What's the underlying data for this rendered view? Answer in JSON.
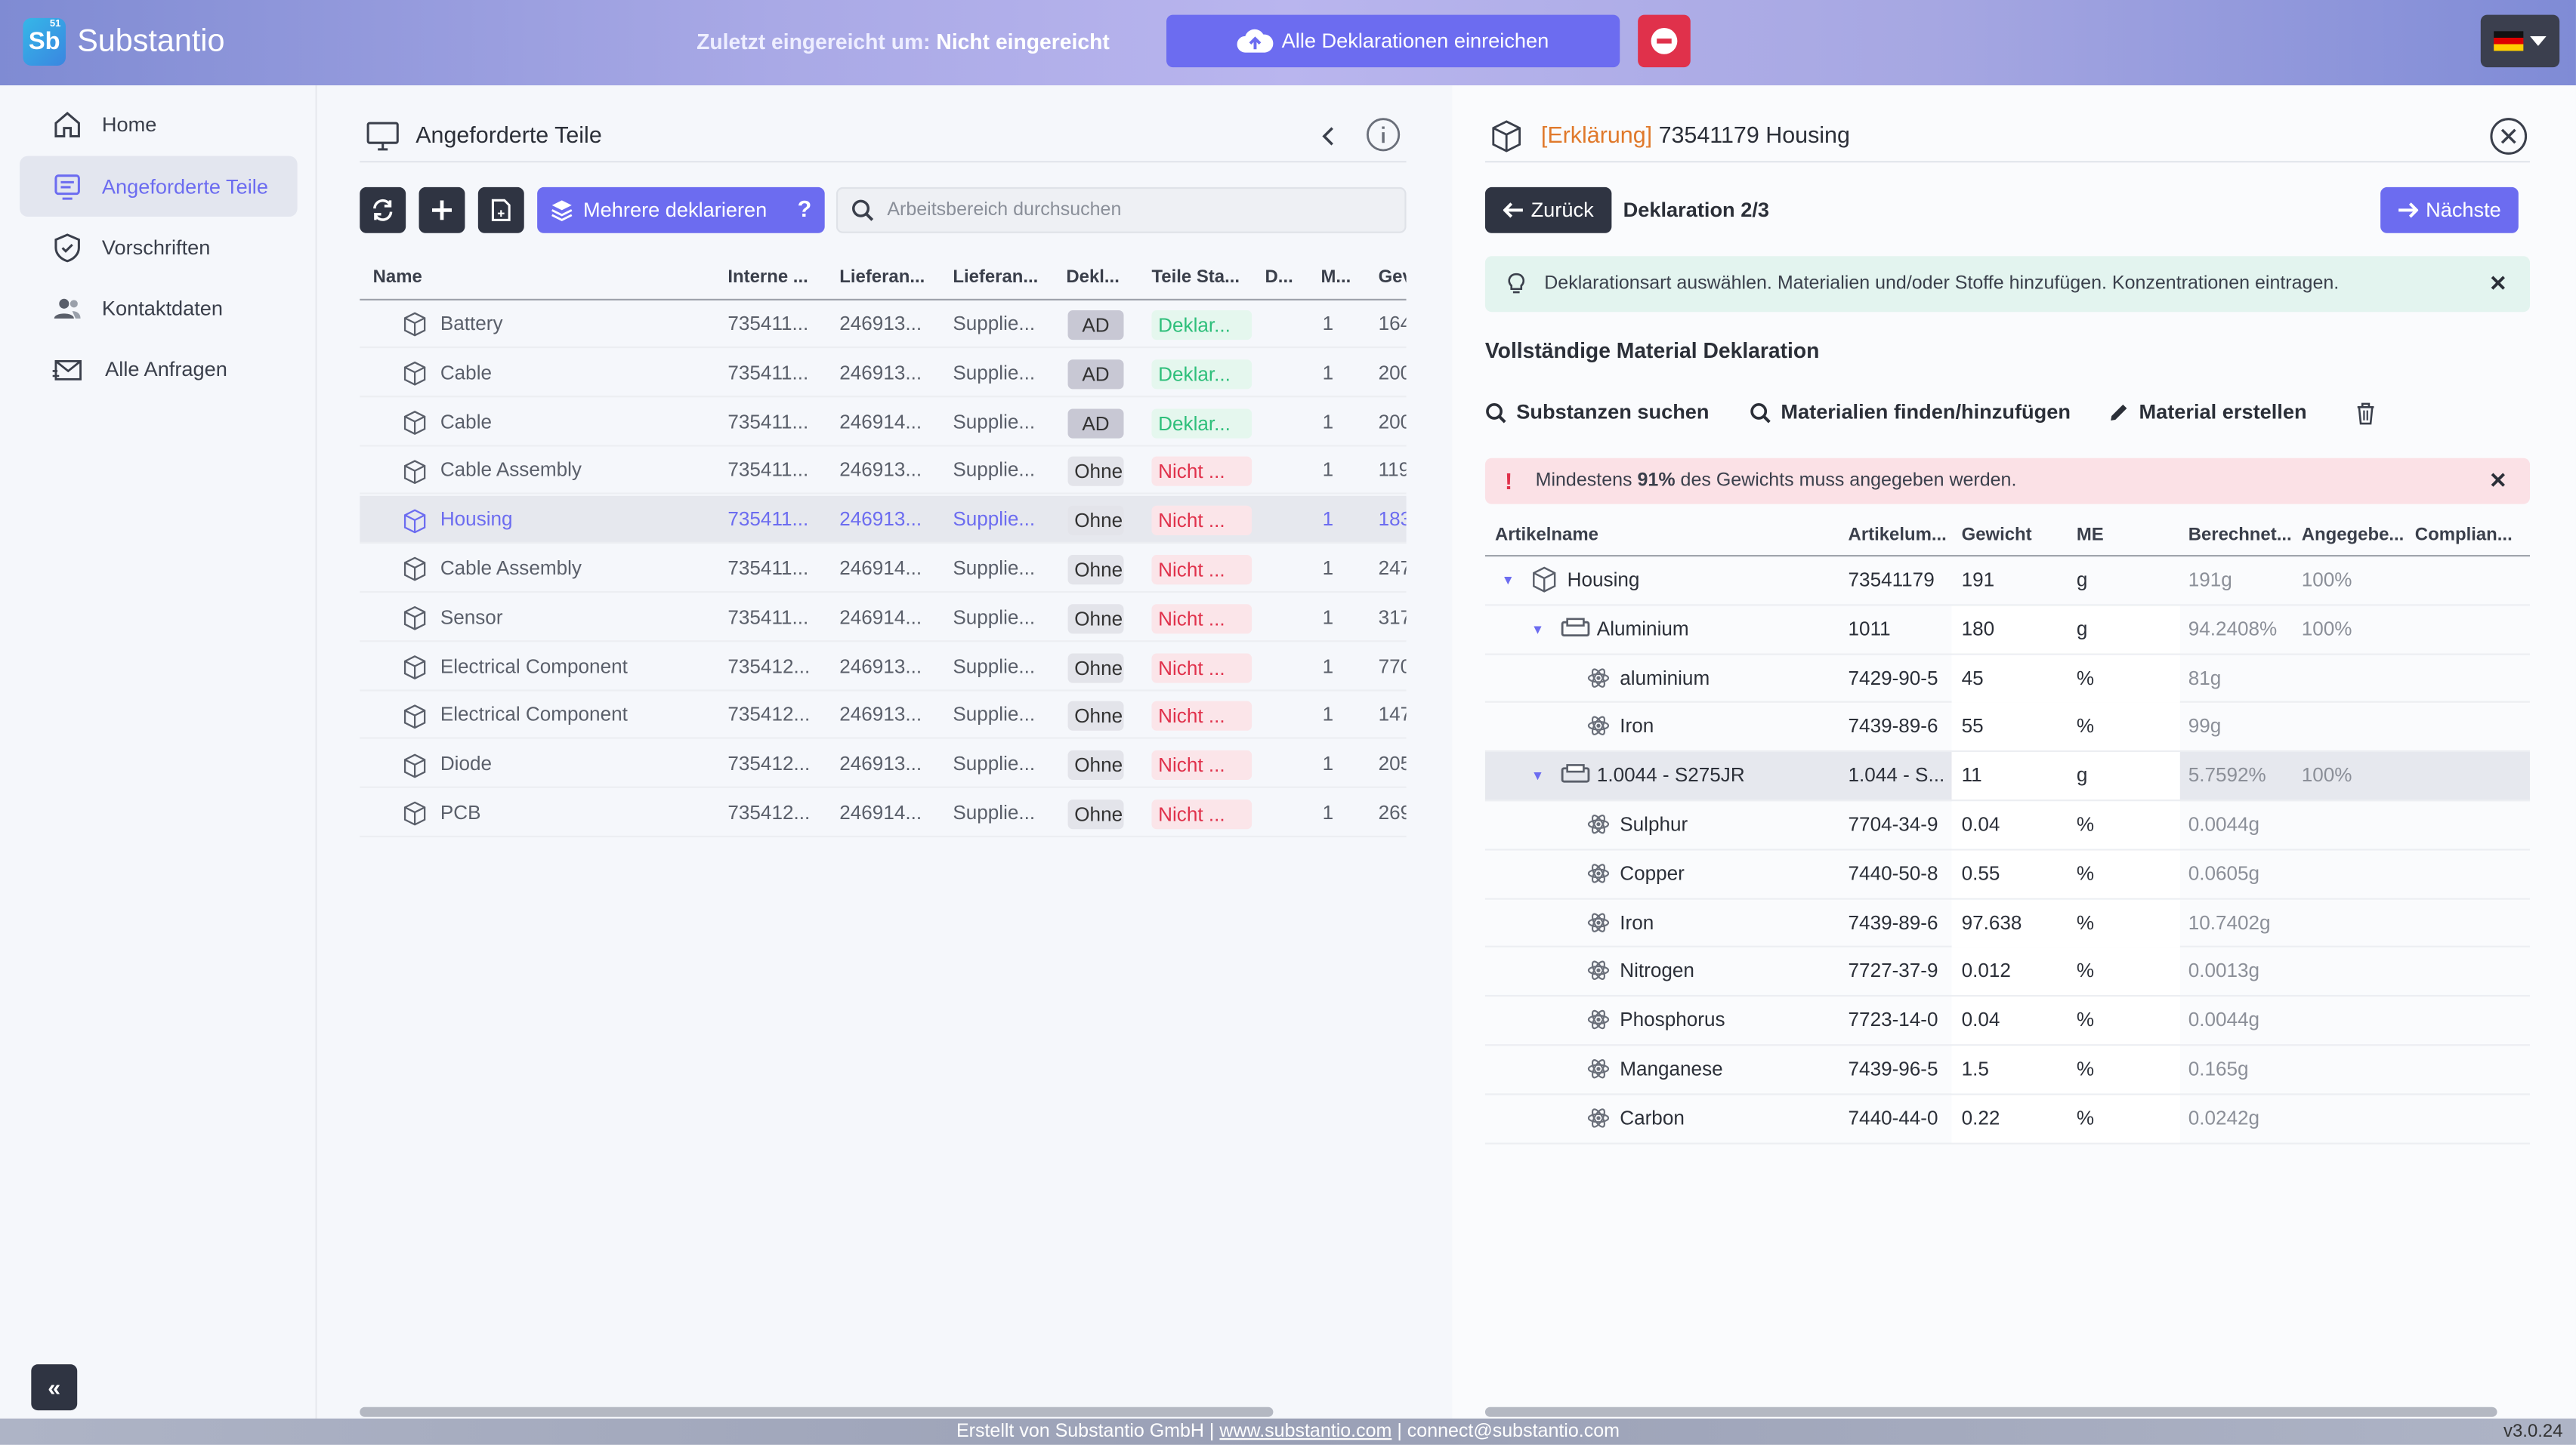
{
  "app": {
    "logo_letters": "Sb",
    "logo_sup": "51",
    "name": "Substantio"
  },
  "topbar": {
    "submitted_label": "Zuletzt eingereicht um:",
    "submitted_value": "Nicht eingereicht",
    "submit_all_label": "Alle Deklarationen einreichen",
    "accent": "#6c6cf0",
    "danger": "#e0314b"
  },
  "sidebar": {
    "items": [
      {
        "label": "Home",
        "icon": "home-icon"
      },
      {
        "label": "Angeforderte Teile",
        "icon": "list-icon"
      },
      {
        "label": "Vorschriften",
        "icon": "shield-icon"
      },
      {
        "label": "Kontaktdaten",
        "icon": "contacts-icon"
      },
      {
        "label": "Alle Anfragen",
        "icon": "mail-icon"
      }
    ],
    "collapse_label": "«"
  },
  "center": {
    "title": "Angeforderte Teile",
    "multi_label": "Mehrere deklarieren",
    "multi_help": "?",
    "search_placeholder": "Arbeitsbereich durchsuchen",
    "columns": [
      "Name",
      "Interne ...",
      "Lieferan...",
      "Lieferan...",
      "Dekl...",
      "Teile Sta...",
      "D...",
      "M...",
      "Gev"
    ],
    "rows": [
      {
        "name": "Battery",
        "internal": "735411...",
        "supnum": "246913...",
        "supname": "Supplie...",
        "dekl": "AD",
        "status": "Deklar...",
        "m": "1",
        "gew": "164"
      },
      {
        "name": "Cable",
        "internal": "735411...",
        "supnum": "246913...",
        "supname": "Supplie...",
        "dekl": "AD",
        "status": "Deklar...",
        "m": "1",
        "gew": "200"
      },
      {
        "name": "Cable",
        "internal": "735411...",
        "supnum": "246914...",
        "supname": "Supplie...",
        "dekl": "AD",
        "status": "Deklar...",
        "m": "1",
        "gew": "200"
      },
      {
        "name": "Cable Assembly",
        "internal": "735411...",
        "supnum": "246913...",
        "supname": "Supplie...",
        "dekl": "Ohne",
        "status": "Nicht ...",
        "m": "1",
        "gew": "119"
      },
      {
        "name": "Housing",
        "internal": "735411...",
        "supnum": "246913...",
        "supname": "Supplie...",
        "dekl": "Ohne",
        "status": "Nicht ...",
        "m": "1",
        "gew": "183"
      },
      {
        "name": "Cable Assembly",
        "internal": "735411...",
        "supnum": "246914...",
        "supname": "Supplie...",
        "dekl": "Ohne",
        "status": "Nicht ...",
        "m": "1",
        "gew": "247"
      },
      {
        "name": "Sensor",
        "internal": "735411...",
        "supnum": "246914...",
        "supname": "Supplie...",
        "dekl": "Ohne",
        "status": "Nicht ...",
        "m": "1",
        "gew": "317"
      },
      {
        "name": "Electrical Component",
        "internal": "735412...",
        "supnum": "246913...",
        "supname": "Supplie...",
        "dekl": "Ohne",
        "status": "Nicht ...",
        "m": "1",
        "gew": "770"
      },
      {
        "name": "Electrical Component",
        "internal": "735412...",
        "supnum": "246913...",
        "supname": "Supplie...",
        "dekl": "Ohne",
        "status": "Nicht ...",
        "m": "1",
        "gew": "147"
      },
      {
        "name": "Diode",
        "internal": "735412...",
        "supnum": "246913...",
        "supname": "Supplie...",
        "dekl": "Ohne",
        "status": "Nicht ...",
        "m": "1",
        "gew": "205"
      },
      {
        "name": "PCB",
        "internal": "735412...",
        "supnum": "246914...",
        "supname": "Supplie...",
        "dekl": "Ohne",
        "status": "Nicht ...",
        "m": "1",
        "gew": "269"
      }
    ]
  },
  "detail": {
    "title_tag": "[Erklärung]",
    "title_text": "73541179 Housing",
    "back_label": "Zurück",
    "progress_label": "Deklaration 2/3",
    "next_label": "Nächste",
    "info_text": "Deklarationsart auswählen. Materialien und/oder Stoffe hinzufügen. Konzentrationen eintragen.",
    "section_title": "Vollständige Material Deklaration",
    "tools": {
      "search_substances": "Substanzen suchen",
      "find_materials": "Materialien finden/hinzufügen",
      "create_material": "Material erstellen"
    },
    "error_pre": "Mindestens",
    "error_pct": "91%",
    "error_post": "des Gewichts muss angegeben werden.",
    "columns": [
      "Artikelname",
      "Artikelum...",
      "Gewicht",
      "ME",
      "Berechnet...",
      "Angegebe...",
      "Complian..."
    ],
    "rows": [
      {
        "level": 0,
        "type": "part",
        "name": "Housing",
        "num": "73541179",
        "weight": "191",
        "unit": "g",
        "calc": "191g",
        "given": "100%"
      },
      {
        "level": 1,
        "type": "material",
        "name": "Aluminium",
        "num": "1011",
        "weight": "180",
        "unit": "g",
        "calc": "94.2408%",
        "given": "100%"
      },
      {
        "level": 2,
        "type": "substance",
        "name": "aluminium",
        "num": "7429-90-5",
        "weight": "45",
        "unit": "%",
        "calc": "81g",
        "given": ""
      },
      {
        "level": 2,
        "type": "substance",
        "name": "Iron",
        "num": "7439-89-6",
        "weight": "55",
        "unit": "%",
        "calc": "99g",
        "given": ""
      },
      {
        "level": 1,
        "type": "material",
        "name": "1.0044 - S275JR",
        "num": "1.044 - S...",
        "weight": "11",
        "unit": "g",
        "calc": "5.7592%",
        "given": "100%"
      },
      {
        "level": 2,
        "type": "substance",
        "name": "Sulphur",
        "num": "7704-34-9",
        "weight": "0.04",
        "unit": "%",
        "calc": "0.0044g",
        "given": ""
      },
      {
        "level": 2,
        "type": "substance",
        "name": "Copper",
        "num": "7440-50-8",
        "weight": "0.55",
        "unit": "%",
        "calc": "0.0605g",
        "given": ""
      },
      {
        "level": 2,
        "type": "substance",
        "name": "Iron",
        "num": "7439-89-6",
        "weight": "97.638",
        "unit": "%",
        "calc": "10.7402g",
        "given": ""
      },
      {
        "level": 2,
        "type": "substance",
        "name": "Nitrogen",
        "num": "7727-37-9",
        "weight": "0.012",
        "unit": "%",
        "calc": "0.0013g",
        "given": ""
      },
      {
        "level": 2,
        "type": "substance",
        "name": "Phosphorus",
        "num": "7723-14-0",
        "weight": "0.04",
        "unit": "%",
        "calc": "0.0044g",
        "given": ""
      },
      {
        "level": 2,
        "type": "substance",
        "name": "Manganese",
        "num": "7439-96-5",
        "weight": "1.5",
        "unit": "%",
        "calc": "0.165g",
        "given": ""
      },
      {
        "level": 2,
        "type": "substance",
        "name": "Carbon",
        "num": "7440-44-0",
        "weight": "0.22",
        "unit": "%",
        "calc": "0.0242g",
        "given": ""
      }
    ]
  },
  "footer": {
    "created_by": "Erstellt von Substantio GmbH |",
    "website": "www.substantio.com",
    "email": "| connect@substantio.com",
    "version": "v3.0.24"
  }
}
